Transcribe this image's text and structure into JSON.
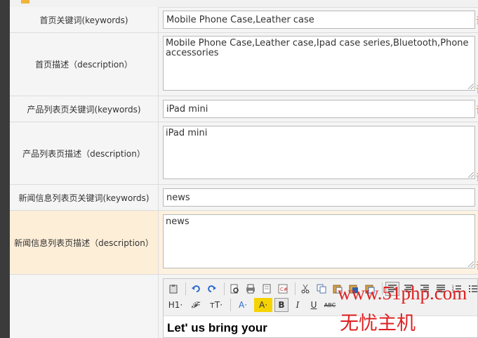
{
  "rows": [
    {
      "label": "首页关键词(keywords)",
      "value": "Mobile Phone Case,Leather case",
      "note": "请"
    },
    {
      "label": "首页描述（description）",
      "value": "Mobile Phone Case,Leather case,Ipad case series,Bluetooth,Phone accessories",
      "note": "请"
    },
    {
      "label": "产品列表页关键词(keywords)",
      "value": "iPad mini",
      "note": "请"
    },
    {
      "label": "产品列表页描述（description）",
      "value": "iPad mini",
      "note": "请"
    },
    {
      "label": "新闻信息列表页关键词(keywords)",
      "value": "news",
      "note": ""
    },
    {
      "label": "新闻信息列表页描述（description）",
      "value": "news",
      "note": "请"
    }
  ],
  "editor": {
    "toolbar_row1": [
      "paste-text-icon",
      "undo-icon",
      "redo-icon",
      "preview-icon",
      "print-icon",
      "template-icon",
      "code-icon",
      "cut-icon",
      "copy-icon",
      "paste-icon",
      "paste-word-icon",
      "select-all-icon",
      "align-left-icon",
      "align-center-icon",
      "align-right-icon",
      "align-justify-icon",
      "ordered-list-icon",
      "unordered-list-icon"
    ],
    "toolbar_row2_labels": {
      "heading": "H1·",
      "font": "𝓕·",
      "size": "тT·",
      "color": "A·",
      "bg": "A·",
      "bold": "B",
      "italic": "I",
      "underline": "U",
      "strike": "ABC"
    },
    "content": "Let' us bring your"
  },
  "watermark": {
    "url": "www.51php.com",
    "name": "无忧主机"
  }
}
